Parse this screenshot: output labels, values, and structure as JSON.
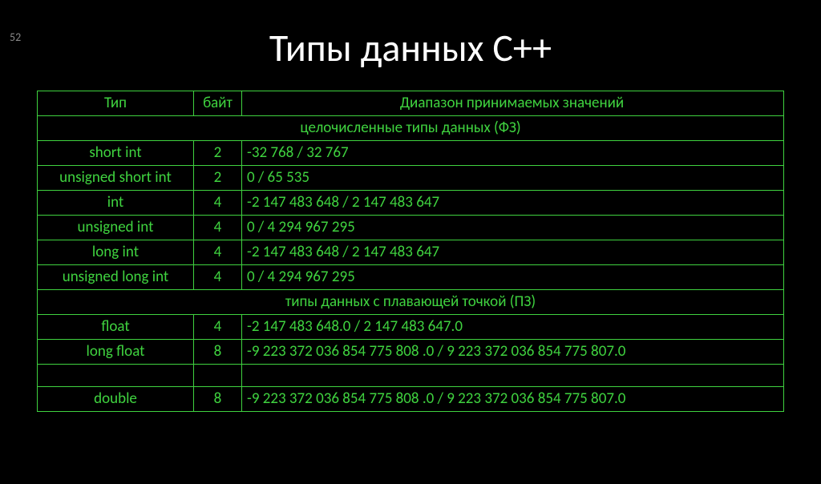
{
  "slide_number": "52",
  "title": "Типы данных С++",
  "header": {
    "type": "Тип",
    "bytes": "байт",
    "range": "Диапазон принимаемых значений"
  },
  "section_int": "целочисленные типы данных (ФЗ)",
  "section_float": "типы данных с плавающей точкой  (ПЗ)",
  "rows_int": [
    {
      "type": "short int",
      "bytes": "2",
      "range": "-32 768   /   32 767"
    },
    {
      "type": "unsigned short int",
      "bytes": "2",
      "range": "0  /  65 535"
    },
    {
      "type": "int",
      "bytes": "4",
      "range": "-2 147 483 648   /   2 147 483 647"
    },
    {
      "type": "unsigned int",
      "bytes": "4",
      "range": "0    /    4 294 967 295"
    },
    {
      "type": "long int",
      "bytes": "4",
      "range": "-2 147 483 648   /   2 147 483 647"
    },
    {
      "type": "unsigned long int",
      "bytes": "4",
      "range": "0    /    4 294 967 295"
    }
  ],
  "rows_float": [
    {
      "type": "float",
      "bytes": "4",
      "range": "-2 147 483 648.0  / 2 147 483 647.0"
    },
    {
      "type": "long float",
      "bytes": "8",
      "range": "-9 223 372 036 854 775 808 .0   /   9 223 372 036 854 775 807.0"
    }
  ],
  "rows_double": [
    {
      "type": "double",
      "bytes": "8",
      "range": "-9 223 372 036 854 775 808 .0   /   9 223 372 036 854 775 807.0"
    }
  ]
}
